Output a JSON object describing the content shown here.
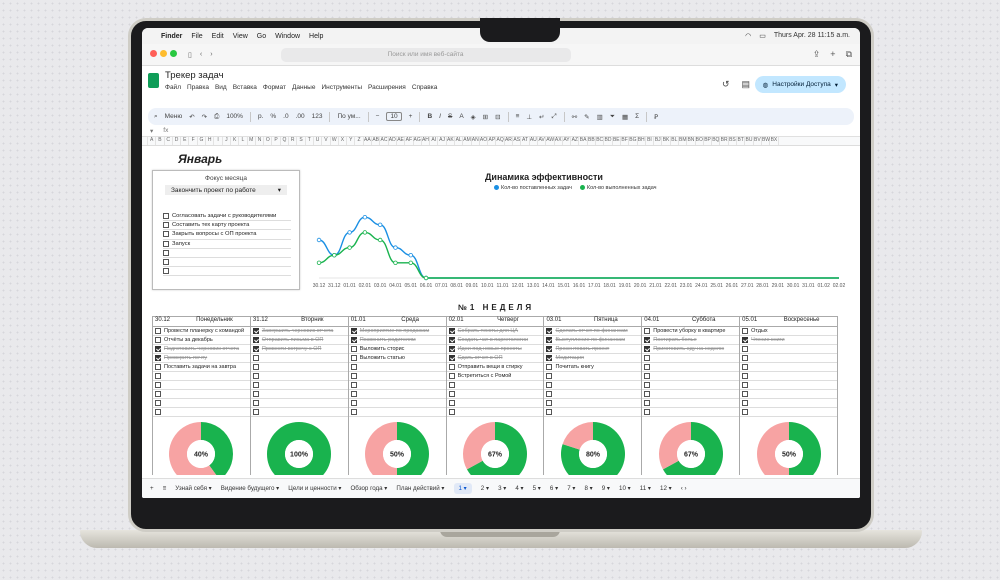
{
  "menubar": {
    "apple": "",
    "app": "Finder",
    "items": [
      "File",
      "Edit",
      "View",
      "Go",
      "Window",
      "Help"
    ],
    "clock": "Thurs Apr. 28 11:15 a.m."
  },
  "browser": {
    "url_placeholder": "Поиск или имя веб-сайта"
  },
  "doc": {
    "title": "Трекер задач",
    "menus": [
      "Файл",
      "Правка",
      "Вид",
      "Вставка",
      "Формат",
      "Данные",
      "Инструменты",
      "Расширения",
      "Справка"
    ],
    "share": "Настройки Доступа"
  },
  "toolbar": {
    "menu": "Меню",
    "zoom": "100%",
    "currency": "р.",
    "percent": "%",
    "dec1": ".0",
    "dec2": ".00",
    "num": "123",
    "font": "По ум...",
    "size": "10"
  },
  "colheads": [
    "A",
    "B",
    "C",
    "D",
    "E",
    "F",
    "G",
    "H",
    "I",
    "J",
    "K",
    "L",
    "M",
    "N",
    "O",
    "P",
    "Q",
    "R",
    "S",
    "T",
    "U",
    "V",
    "W",
    "X",
    "Y",
    "Z",
    "AA",
    "AB",
    "AC",
    "AD",
    "AE",
    "AF",
    "AG",
    "AH",
    "AI",
    "AJ",
    "AK",
    "AL",
    "AM",
    "AN",
    "AO",
    "AP",
    "AQ",
    "AR",
    "AS",
    "AT",
    "AU",
    "AV",
    "AW",
    "AX",
    "AY",
    "AZ",
    "BA",
    "BB",
    "BC",
    "BD",
    "BE",
    "BF",
    "BG",
    "BH",
    "BI",
    "BJ",
    "BK",
    "BL",
    "BM",
    "BN",
    "BO",
    "BP",
    "BQ",
    "BR",
    "BS",
    "BT",
    "BU",
    "BV",
    "BW",
    "BX"
  ],
  "month": "Январь",
  "focus": {
    "title": "Фокус месяца",
    "selected": "Закончить проект по работе",
    "goals": [
      "Согласовать задачи с руководителями",
      "Составить тех карту проекта",
      "Закрыть вопросы с ОП проекта",
      "Запуск",
      "",
      "",
      ""
    ]
  },
  "chart_data": {
    "type": "line",
    "title": "Динамика эффективности",
    "series": [
      {
        "name": "Кол-во поставленных задач",
        "color": "#1a8fe3",
        "values": [
          5,
          3,
          6,
          8,
          7,
          4,
          3,
          0,
          0,
          0,
          0,
          0,
          0,
          0,
          0,
          0,
          0,
          0,
          0,
          0,
          0,
          0,
          0,
          0,
          0,
          0,
          0,
          0,
          0,
          0,
          0,
          0,
          0,
          0,
          0,
          0,
          0,
          0,
          0,
          0,
          0,
          0,
          0,
          0,
          0,
          0,
          0,
          0,
          0,
          0,
          0,
          0,
          0,
          0,
          0,
          0,
          0
        ]
      },
      {
        "name": "Кол-во выполненных задач",
        "color": "#19b34e",
        "values": [
          2,
          3,
          4,
          6,
          5,
          2,
          2,
          0,
          0,
          0,
          0,
          0,
          0,
          0,
          0,
          0,
          0,
          0,
          0,
          0,
          0,
          0,
          0,
          0,
          0,
          0,
          0,
          0,
          0,
          0,
          0,
          0,
          0,
          0,
          0,
          0,
          0,
          0,
          0,
          0,
          0,
          0,
          0,
          0,
          0,
          0,
          0,
          0,
          0,
          0,
          0,
          0,
          0,
          0,
          0,
          0,
          0
        ]
      }
    ],
    "xticks": [
      "30.12",
      "31.12",
      "01.01",
      "02.01",
      "03.01",
      "04.01",
      "05.01",
      "06.01",
      "07.01",
      "08.01",
      "09.01",
      "10.01",
      "11.01",
      "12.01",
      "13.01",
      "14.01",
      "15.01",
      "16.01",
      "17.01",
      "18.01",
      "19.01",
      "20.01",
      "21.01",
      "22.01",
      "23.01",
      "24.01",
      "25.01",
      "26.01",
      "27.01",
      "28.01",
      "29.01",
      "30.01",
      "31.01",
      "01.02",
      "02.02"
    ]
  },
  "week_title": "№1 НЕДЕЛЯ",
  "days": [
    {
      "date": "30.12",
      "name": "Понедельник",
      "tasks": [
        {
          "t": "Провести планерку с командой",
          "c": false
        },
        {
          "t": "Отчёты за декабрь",
          "c": false
        },
        {
          "t": "Подготовить черновик отчета",
          "c": true
        },
        {
          "t": "Проверить почту",
          "c": true
        },
        {
          "t": "Поставить задачи на завтра",
          "c": false
        },
        {
          "t": "",
          "c": false
        },
        {
          "t": "",
          "c": false
        },
        {
          "t": "",
          "c": false
        },
        {
          "t": "",
          "c": false
        },
        {
          "t": "",
          "c": false
        }
      ],
      "pct": 40,
      "label": "40%"
    },
    {
      "date": "31.12",
      "name": "Вторник",
      "tasks": [
        {
          "t": "Завершить черновик отчета",
          "c": true
        },
        {
          "t": "Отправить письма в ОП",
          "c": true
        },
        {
          "t": "Провести встречу с ОП",
          "c": true
        },
        {
          "t": "",
          "c": false
        },
        {
          "t": "",
          "c": false
        },
        {
          "t": "",
          "c": false
        },
        {
          "t": "",
          "c": false
        },
        {
          "t": "",
          "c": false
        },
        {
          "t": "",
          "c": false
        },
        {
          "t": "",
          "c": false
        }
      ],
      "pct": 100,
      "label": "100%"
    },
    {
      "date": "01.01",
      "name": "Среда",
      "tasks": [
        {
          "t": "Мероприятие по продажам",
          "c": true
        },
        {
          "t": "Позвонить родителям",
          "c": true
        },
        {
          "t": "Выложить сторис",
          "c": false
        },
        {
          "t": "Выложить статью",
          "c": false
        },
        {
          "t": "",
          "c": false
        },
        {
          "t": "",
          "c": false
        },
        {
          "t": "",
          "c": false
        },
        {
          "t": "",
          "c": false
        },
        {
          "t": "",
          "c": false
        },
        {
          "t": "",
          "c": false
        }
      ],
      "pct": 50,
      "label": "50%"
    },
    {
      "date": "02.01",
      "name": "Четверг",
      "tasks": [
        {
          "t": "Собрать тексты для ЦА",
          "c": true
        },
        {
          "t": "Создать чат в паргетологии",
          "c": true
        },
        {
          "t": "Идеи под новые проекты",
          "c": true
        },
        {
          "t": "Сдать отчет в ОП",
          "c": true
        },
        {
          "t": "Отправить вещи в стирку",
          "c": false
        },
        {
          "t": "Встретиться с Ромой",
          "c": false
        },
        {
          "t": "",
          "c": false
        },
        {
          "t": "",
          "c": false
        },
        {
          "t": "",
          "c": false
        },
        {
          "t": "",
          "c": false
        }
      ],
      "pct": 67,
      "label": "67%"
    },
    {
      "date": "03.01",
      "name": "Пятница",
      "tasks": [
        {
          "t": "Сделать отчет по финансам",
          "c": true
        },
        {
          "t": "Выступление по финансам",
          "c": true
        },
        {
          "t": "Презентовать проект",
          "c": true
        },
        {
          "t": "Медитация",
          "c": true
        },
        {
          "t": "Почитать книгу",
          "c": false
        },
        {
          "t": "",
          "c": false
        },
        {
          "t": "",
          "c": false
        },
        {
          "t": "",
          "c": false
        },
        {
          "t": "",
          "c": false
        },
        {
          "t": "",
          "c": false
        }
      ],
      "pct": 80,
      "label": "80%"
    },
    {
      "date": "04.01",
      "name": "Суббота",
      "tasks": [
        {
          "t": "Провести уборку в квартире",
          "c": false
        },
        {
          "t": "Постирать белье",
          "c": true
        },
        {
          "t": "Приготовить еду на неделю",
          "c": true
        },
        {
          "t": "",
          "c": false
        },
        {
          "t": "",
          "c": false
        },
        {
          "t": "",
          "c": false
        },
        {
          "t": "",
          "c": false
        },
        {
          "t": "",
          "c": false
        },
        {
          "t": "",
          "c": false
        },
        {
          "t": "",
          "c": false
        }
      ],
      "pct": 67,
      "label": "67%"
    },
    {
      "date": "05.01",
      "name": "Воскресенье",
      "tasks": [
        {
          "t": "Отдых",
          "c": false
        },
        {
          "t": "Чтение книги",
          "c": true
        },
        {
          "t": "",
          "c": false
        },
        {
          "t": "",
          "c": false
        },
        {
          "t": "",
          "c": false
        },
        {
          "t": "",
          "c": false
        },
        {
          "t": "",
          "c": false
        },
        {
          "t": "",
          "c": false
        },
        {
          "t": "",
          "c": false
        },
        {
          "t": "",
          "c": false
        }
      ],
      "pct": 50,
      "label": "50%"
    }
  ],
  "tabs": [
    "Узнай себя",
    "Видение будущего",
    "Цели и ценности",
    "Обзор года",
    "План действий",
    "1",
    "2",
    "3",
    "4",
    "5",
    "6",
    "7",
    "8",
    "9",
    "10",
    "11",
    "12"
  ],
  "colors": {
    "green": "#19b34e",
    "pink": "#f7a3a3",
    "blue": "#1a8fe3"
  }
}
